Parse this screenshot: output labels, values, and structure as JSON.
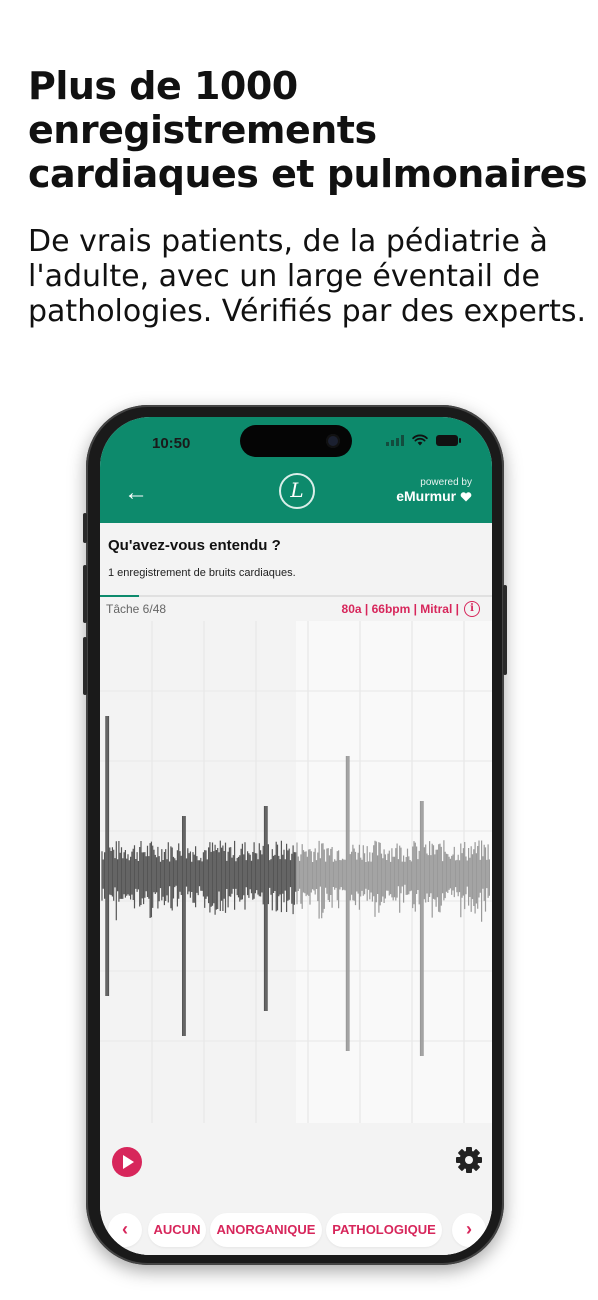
{
  "headline": "Plus de 1000 enregistrements cardiaques et pulmonaires",
  "subhead": "De vrais patients, de la pédiatrie à l'adulte, avec un large éventail de pathologies. Vérifiés par des experts.",
  "status_bar": {
    "time": "10:50"
  },
  "app_bar": {
    "back_icon": "←",
    "logo_letter": "L",
    "powered_by": "powered by",
    "brand": "eMurmur"
  },
  "question": {
    "title": "Qu'avez-vous entendu ?",
    "subtitle": "1 enregistrement de bruits cardiaques."
  },
  "task": {
    "label": "Tâche 6/48",
    "progress": 0.1
  },
  "recording_info": {
    "text": "80a | 66bpm | Mitral |",
    "info_icon": "i"
  },
  "answers": {
    "prev_icon": "‹",
    "options": [
      "AUCUN",
      "ANORGANIQUE",
      "PATHOLOGIQUE"
    ],
    "next_icon": "›"
  },
  "colors": {
    "primary_green": "#0d8a6c",
    "accent_pink": "#d7265b"
  },
  "playback": {
    "played_fraction": 0.5
  }
}
